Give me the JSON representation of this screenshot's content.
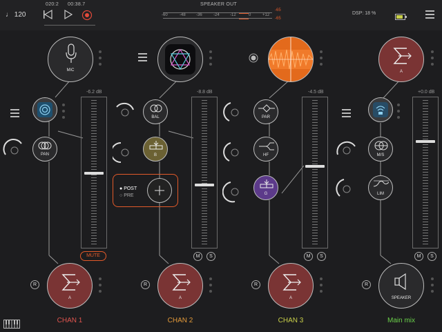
{
  "topbar": {
    "tempo": "♩ 120",
    "position": "020:2",
    "time": "00:38.7",
    "meter_title": "SPEAKER OUT",
    "meter_scale": [
      "-60",
      "-48",
      "-36",
      "-24",
      "-12",
      "0",
      "+12"
    ],
    "peak_l": "-65",
    "peak_r": "-65",
    "dsp": "DSP: 18 %"
  },
  "nodes": {
    "mic": "MIC",
    "pan": "PAN",
    "bal": "BAL",
    "b": "B",
    "par": "PAR",
    "hf": "HF",
    "g": "G",
    "a_top": "A",
    "ms": "M/S",
    "lim": "LIM",
    "ch1_bus": "A",
    "ch2_bus": "A",
    "ch3_bus": "A",
    "speaker": "SPEAKER"
  },
  "send": {
    "post": "POST",
    "pre": "PRE"
  },
  "faders": [
    {
      "db": "-6.2 dB",
      "level": 0.5
    },
    {
      "db": "-8.8 dB",
      "level": 0.42
    },
    {
      "db": "-4.5 dB",
      "level": 0.55
    },
    {
      "db": "+0.0 dB",
      "level": 0.72
    }
  ],
  "buttons": {
    "mute": "MUTE",
    "m": "M",
    "s": "S",
    "r": "R"
  },
  "channels": [
    {
      "name": "CHAN 1",
      "color": "#e0554f"
    },
    {
      "name": "CHAN 2",
      "color": "#e39a3a"
    },
    {
      "name": "CHAN 3",
      "color": "#c9d04a"
    },
    {
      "name": "Main mix",
      "color": "#6ad04a"
    }
  ],
  "colors": {
    "bus": "#7a3434",
    "b_node": "#6b6133",
    "g_node": "#5c3a8a",
    "accent": "#e35a2a"
  }
}
